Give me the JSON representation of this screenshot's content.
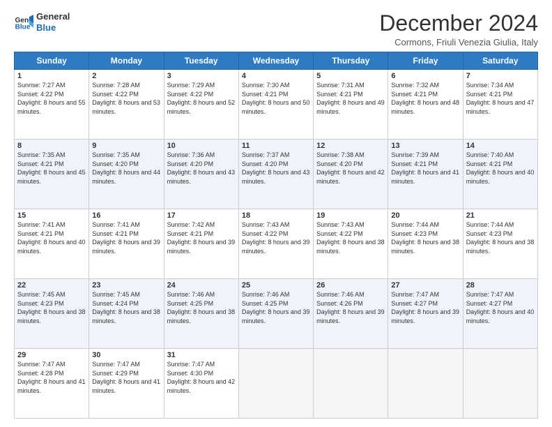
{
  "logo": {
    "line1": "General",
    "line2": "Blue"
  },
  "title": "December 2024",
  "location": "Cormons, Friuli Venezia Giulia, Italy",
  "weekdays": [
    "Sunday",
    "Monday",
    "Tuesday",
    "Wednesday",
    "Thursday",
    "Friday",
    "Saturday"
  ],
  "weeks": [
    [
      {
        "day": "1",
        "sunrise": "7:27 AM",
        "sunset": "4:22 PM",
        "daylight": "8 hours and 55 minutes."
      },
      {
        "day": "2",
        "sunrise": "7:28 AM",
        "sunset": "4:22 PM",
        "daylight": "8 hours and 53 minutes."
      },
      {
        "day": "3",
        "sunrise": "7:29 AM",
        "sunset": "4:22 PM",
        "daylight": "8 hours and 52 minutes."
      },
      {
        "day": "4",
        "sunrise": "7:30 AM",
        "sunset": "4:21 PM",
        "daylight": "8 hours and 50 minutes."
      },
      {
        "day": "5",
        "sunrise": "7:31 AM",
        "sunset": "4:21 PM",
        "daylight": "8 hours and 49 minutes."
      },
      {
        "day": "6",
        "sunrise": "7:32 AM",
        "sunset": "4:21 PM",
        "daylight": "8 hours and 48 minutes."
      },
      {
        "day": "7",
        "sunrise": "7:34 AM",
        "sunset": "4:21 PM",
        "daylight": "8 hours and 47 minutes."
      }
    ],
    [
      {
        "day": "8",
        "sunrise": "7:35 AM",
        "sunset": "4:21 PM",
        "daylight": "8 hours and 45 minutes."
      },
      {
        "day": "9",
        "sunrise": "7:35 AM",
        "sunset": "4:20 PM",
        "daylight": "8 hours and 44 minutes."
      },
      {
        "day": "10",
        "sunrise": "7:36 AM",
        "sunset": "4:20 PM",
        "daylight": "8 hours and 43 minutes."
      },
      {
        "day": "11",
        "sunrise": "7:37 AM",
        "sunset": "4:20 PM",
        "daylight": "8 hours and 43 minutes."
      },
      {
        "day": "12",
        "sunrise": "7:38 AM",
        "sunset": "4:20 PM",
        "daylight": "8 hours and 42 minutes."
      },
      {
        "day": "13",
        "sunrise": "7:39 AM",
        "sunset": "4:21 PM",
        "daylight": "8 hours and 41 minutes."
      },
      {
        "day": "14",
        "sunrise": "7:40 AM",
        "sunset": "4:21 PM",
        "daylight": "8 hours and 40 minutes."
      }
    ],
    [
      {
        "day": "15",
        "sunrise": "7:41 AM",
        "sunset": "4:21 PM",
        "daylight": "8 hours and 40 minutes."
      },
      {
        "day": "16",
        "sunrise": "7:41 AM",
        "sunset": "4:21 PM",
        "daylight": "8 hours and 39 minutes."
      },
      {
        "day": "17",
        "sunrise": "7:42 AM",
        "sunset": "4:21 PM",
        "daylight": "8 hours and 39 minutes."
      },
      {
        "day": "18",
        "sunrise": "7:43 AM",
        "sunset": "4:22 PM",
        "daylight": "8 hours and 39 minutes."
      },
      {
        "day": "19",
        "sunrise": "7:43 AM",
        "sunset": "4:22 PM",
        "daylight": "8 hours and 38 minutes."
      },
      {
        "day": "20",
        "sunrise": "7:44 AM",
        "sunset": "4:23 PM",
        "daylight": "8 hours and 38 minutes."
      },
      {
        "day": "21",
        "sunrise": "7:44 AM",
        "sunset": "4:23 PM",
        "daylight": "8 hours and 38 minutes."
      }
    ],
    [
      {
        "day": "22",
        "sunrise": "7:45 AM",
        "sunset": "4:23 PM",
        "daylight": "8 hours and 38 minutes."
      },
      {
        "day": "23",
        "sunrise": "7:45 AM",
        "sunset": "4:24 PM",
        "daylight": "8 hours and 38 minutes."
      },
      {
        "day": "24",
        "sunrise": "7:46 AM",
        "sunset": "4:25 PM",
        "daylight": "8 hours and 38 minutes."
      },
      {
        "day": "25",
        "sunrise": "7:46 AM",
        "sunset": "4:25 PM",
        "daylight": "8 hours and 39 minutes."
      },
      {
        "day": "26",
        "sunrise": "7:46 AM",
        "sunset": "4:26 PM",
        "daylight": "8 hours and 39 minutes."
      },
      {
        "day": "27",
        "sunrise": "7:47 AM",
        "sunset": "4:27 PM",
        "daylight": "8 hours and 39 minutes."
      },
      {
        "day": "28",
        "sunrise": "7:47 AM",
        "sunset": "4:27 PM",
        "daylight": "8 hours and 40 minutes."
      }
    ],
    [
      {
        "day": "29",
        "sunrise": "7:47 AM",
        "sunset": "4:28 PM",
        "daylight": "8 hours and 41 minutes."
      },
      {
        "day": "30",
        "sunrise": "7:47 AM",
        "sunset": "4:29 PM",
        "daylight": "8 hours and 41 minutes."
      },
      {
        "day": "31",
        "sunrise": "7:47 AM",
        "sunset": "4:30 PM",
        "daylight": "8 hours and 42 minutes."
      },
      null,
      null,
      null,
      null
    ]
  ]
}
